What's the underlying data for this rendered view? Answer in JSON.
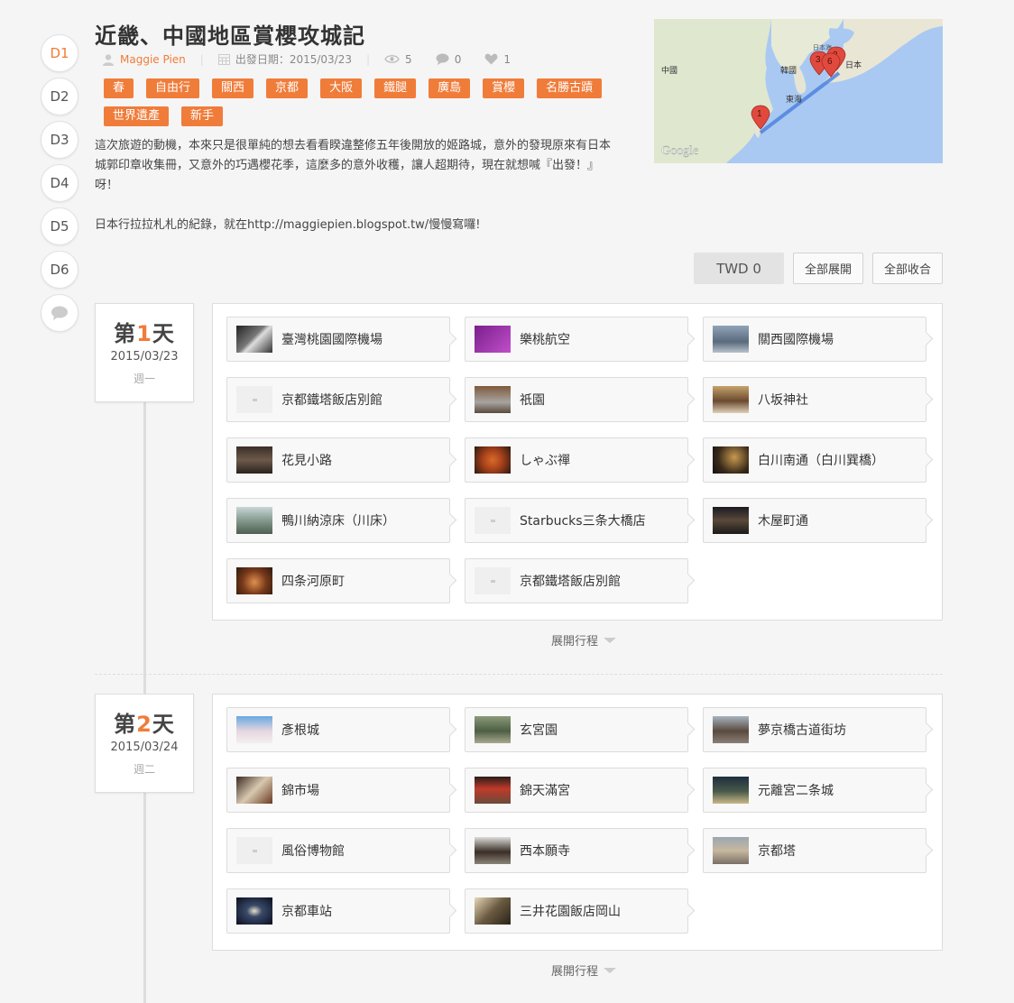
{
  "day_nav": [
    "D1",
    "D2",
    "D3",
    "D4",
    "D5",
    "D6"
  ],
  "trip": {
    "title": "近畿、中國地區賞櫻攻城記",
    "author": "Maggie Pien",
    "date_label": "出發日期：2015/03/23",
    "views": "5",
    "comments": "0",
    "likes": "1",
    "tags": [
      "春",
      "自由行",
      "關西",
      "京都",
      "大阪",
      "鐵腿",
      "廣島",
      "賞櫻",
      "名勝古蹟",
      "世界遺產",
      "新手"
    ],
    "description_lines": [
      "這次旅遊的動機，本來只是很單純的想去看看睽違整修五年後開放的姬路城，意外的發現原來有日本",
      "城郭印章收集冊，又意外的巧遇櫻花季，這麼多的意外收穫，讓人超期待，現在就想喊『出發！』",
      "呀！",
      "",
      "日本行拉拉札札的紀錄，就在http://maggiepien.blogspot.tw/慢慢寫囉!"
    ]
  },
  "map": {
    "labels": {
      "china": "中國",
      "korea": "韓國",
      "japan": "日本",
      "east_sea": "東海",
      "sea_of_japan": "日本海",
      "google": "Google"
    },
    "markers": [
      "1",
      "3",
      "6",
      "3"
    ]
  },
  "toolbar": {
    "currency": "TWD 0",
    "expand_all": "全部展開",
    "collapse_all": "全部收合"
  },
  "days": [
    {
      "prefix": "第",
      "num": "1",
      "suffix": "天",
      "date": "2015/03/23",
      "weekday": "週一",
      "expand_label": "展開行程",
      "places": [
        {
          "name": "臺灣桃園國際機場",
          "thumb": "airport-hall"
        },
        {
          "name": "樂桃航空",
          "thumb": "peach-aviation"
        },
        {
          "name": "關西國際機場",
          "thumb": "kansai-airport"
        },
        {
          "name": "京都鐵塔飯店別館",
          "thumb": "placeholder"
        },
        {
          "name": "祇園",
          "thumb": "gion-street"
        },
        {
          "name": "八坂神社",
          "thumb": "yasaka-shrine"
        },
        {
          "name": "花見小路",
          "thumb": "hanami-lane"
        },
        {
          "name": "しゃぶ禪",
          "thumb": "shabu-food"
        },
        {
          "name": "白川南通（白川巽橋）",
          "thumb": "shirakawa-night"
        },
        {
          "name": "鴨川納涼床（川床）",
          "thumb": "kamogawa-river"
        },
        {
          "name": "Starbucks三条大橋店",
          "thumb": "placeholder"
        },
        {
          "name": "木屋町通",
          "thumb": "kiyamachi-night"
        },
        {
          "name": "四条河原町",
          "thumb": "shijo-dinner"
        },
        {
          "name": "京都鐵塔飯店別館",
          "thumb": "placeholder"
        }
      ]
    },
    {
      "prefix": "第",
      "num": "2",
      "suffix": "天",
      "date": "2015/03/24",
      "weekday": "週二",
      "expand_label": "展開行程",
      "places": [
        {
          "name": "彥根城",
          "thumb": "hikone-castle"
        },
        {
          "name": "玄宮園",
          "thumb": "genkyu-garden"
        },
        {
          "name": "夢京橋古道街坊",
          "thumb": "yumekyobashi-street"
        },
        {
          "name": "錦市場",
          "thumb": "nishiki-market"
        },
        {
          "name": "錦天滿宮",
          "thumb": "nishiki-shrine"
        },
        {
          "name": "元離宮二条城",
          "thumb": "nijo-castle"
        },
        {
          "name": "風俗博物館",
          "thumb": "placeholder"
        },
        {
          "name": "西本願寺",
          "thumb": "nishi-honganji"
        },
        {
          "name": "京都塔",
          "thumb": "kyoto-tower-view"
        },
        {
          "name": "京都車站",
          "thumb": "kyoto-station-night"
        },
        {
          "name": "三井花園飯店岡山",
          "thumb": "hotel-lobby"
        }
      ]
    }
  ],
  "colors": {
    "accent": "#f07c3a",
    "background": "#f5f5f5",
    "route": "#4a7fe0"
  }
}
